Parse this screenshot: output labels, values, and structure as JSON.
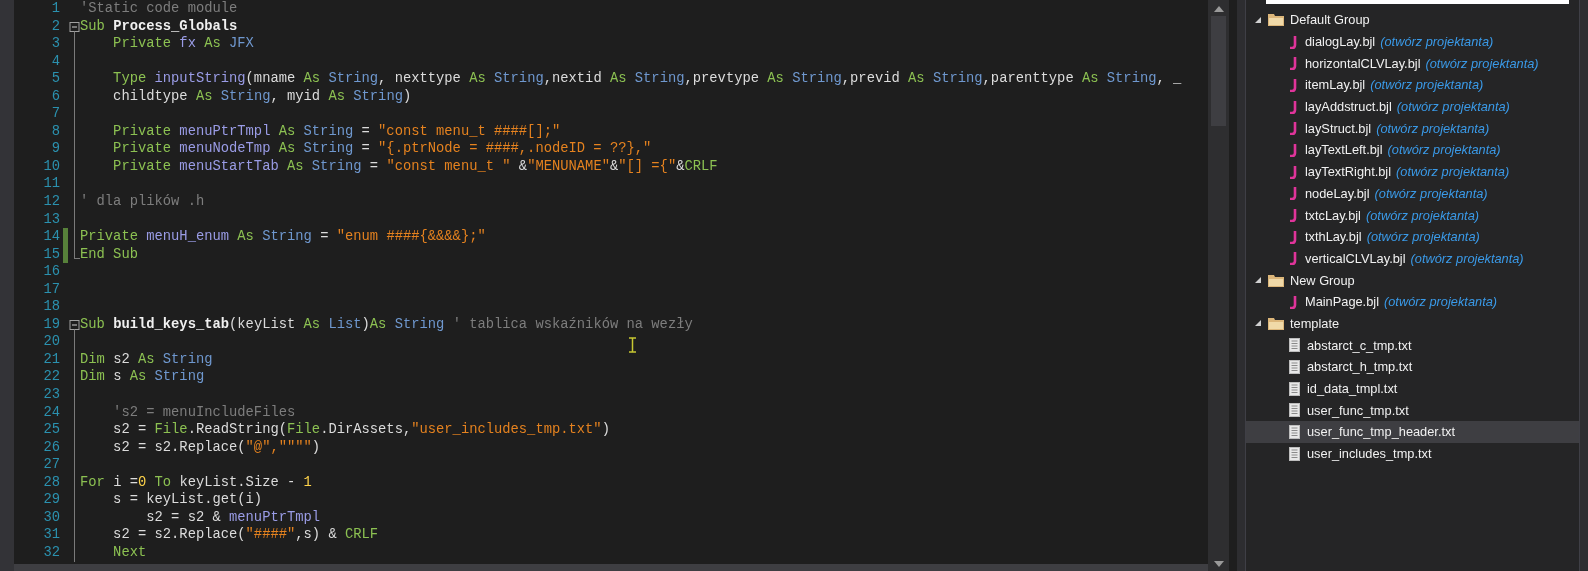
{
  "editor": {
    "lines": [
      {
        "number": "1",
        "kind": "plain",
        "modified": false,
        "tokens": [
          {
            "kind": "comment",
            "text": "'Static code module"
          }
        ]
      },
      {
        "number": "2",
        "kind": "fold_start",
        "modified": false,
        "tokens": [
          {
            "kind": "keyword",
            "text": "Sub "
          },
          {
            "kind": "name",
            "text": "Process_Globals"
          }
        ]
      },
      {
        "number": "3",
        "kind": "in_fold",
        "modified": false,
        "tokens": [
          {
            "kind": "keyword",
            "text": "    Private "
          },
          {
            "kind": "identifier",
            "text": "fx "
          },
          {
            "kind": "keyword",
            "text": "As "
          },
          {
            "kind": "type",
            "text": "JFX"
          }
        ]
      },
      {
        "number": "4",
        "kind": "in_fold",
        "modified": false
      },
      {
        "number": "5",
        "kind": "in_fold",
        "modified": false,
        "tokens": [
          {
            "kind": "keyword",
            "text": "    Type "
          },
          {
            "kind": "identifier",
            "text": "inputString"
          },
          {
            "kind": "plain",
            "text": "(mname "
          },
          {
            "kind": "keyword",
            "text": "As "
          },
          {
            "kind": "type",
            "text": "String"
          },
          {
            "kind": "plain",
            "text": ", nexttype "
          },
          {
            "kind": "keyword",
            "text": "As "
          },
          {
            "kind": "type",
            "text": "String"
          },
          {
            "kind": "plain",
            "text": ",nextid "
          },
          {
            "kind": "keyword",
            "text": "As "
          },
          {
            "kind": "type",
            "text": "String"
          },
          {
            "kind": "plain",
            "text": ",prevtype "
          },
          {
            "kind": "keyword",
            "text": "As "
          },
          {
            "kind": "type",
            "text": "String"
          },
          {
            "kind": "plain",
            "text": ",previd "
          },
          {
            "kind": "keyword",
            "text": "As "
          },
          {
            "kind": "type",
            "text": "String"
          },
          {
            "kind": "plain",
            "text": ",parenttype "
          },
          {
            "kind": "keyword",
            "text": "As "
          },
          {
            "kind": "type",
            "text": "String"
          },
          {
            "kind": "plain",
            "text": ", _"
          }
        ]
      },
      {
        "number": "6",
        "kind": "in_fold",
        "modified": false,
        "tokens": [
          {
            "kind": "plain",
            "text": "    childtype "
          },
          {
            "kind": "keyword",
            "text": "As "
          },
          {
            "kind": "type",
            "text": "String"
          },
          {
            "kind": "plain",
            "text": ", myid "
          },
          {
            "kind": "keyword",
            "text": "As "
          },
          {
            "kind": "type",
            "text": "String"
          },
          {
            "kind": "plain",
            "text": ")"
          }
        ]
      },
      {
        "number": "7",
        "kind": "in_fold",
        "modified": false
      },
      {
        "number": "8",
        "kind": "in_fold",
        "modified": false,
        "tokens": [
          {
            "kind": "keyword",
            "text": "    Private "
          },
          {
            "kind": "identifier",
            "text": "menuPtrTmpl "
          },
          {
            "kind": "keyword",
            "text": "As "
          },
          {
            "kind": "type",
            "text": "String"
          },
          {
            "kind": "plain",
            "text": " = "
          },
          {
            "kind": "string",
            "text": "\"const menu_t ####[];\""
          }
        ]
      },
      {
        "number": "9",
        "kind": "in_fold",
        "modified": false,
        "tokens": [
          {
            "kind": "keyword",
            "text": "    Private "
          },
          {
            "kind": "identifier",
            "text": "menuNodeTmp "
          },
          {
            "kind": "keyword",
            "text": "As "
          },
          {
            "kind": "type",
            "text": "String"
          },
          {
            "kind": "plain",
            "text": " = "
          },
          {
            "kind": "string",
            "text": "\"{.ptrNode = ####,.nodeID = ??},\""
          }
        ]
      },
      {
        "number": "10",
        "kind": "in_fold",
        "modified": false,
        "tokens": [
          {
            "kind": "keyword",
            "text": "    Private "
          },
          {
            "kind": "identifier",
            "text": "menuStartTab "
          },
          {
            "kind": "keyword",
            "text": "As "
          },
          {
            "kind": "type",
            "text": "String"
          },
          {
            "kind": "plain",
            "text": " = "
          },
          {
            "kind": "string",
            "text": "\"const menu_t \""
          },
          {
            "kind": "plain",
            "text": " &"
          },
          {
            "kind": "string",
            "text": "\"MENUNAME\""
          },
          {
            "kind": "plain",
            "text": "&"
          },
          {
            "kind": "string",
            "text": "\"[] ={\""
          },
          {
            "kind": "plain",
            "text": "&"
          },
          {
            "kind": "keyword",
            "text": "CRLF"
          }
        ]
      },
      {
        "number": "11",
        "kind": "in_fold",
        "modified": false
      },
      {
        "number": "12",
        "kind": "in_fold",
        "modified": false,
        "tokens": [
          {
            "kind": "comment",
            "text": "' dla plików .h"
          }
        ]
      },
      {
        "number": "13",
        "kind": "in_fold",
        "modified": false
      },
      {
        "number": "14",
        "kind": "in_fold",
        "modified": true,
        "tokens": [
          {
            "kind": "keyword",
            "text": "Private "
          },
          {
            "kind": "identifier",
            "text": "menuH_enum "
          },
          {
            "kind": "keyword",
            "text": "As "
          },
          {
            "kind": "type",
            "text": "String"
          },
          {
            "kind": "plain",
            "text": " = "
          },
          {
            "kind": "string",
            "text": "\"enum ####{&&&&};\""
          }
        ]
      },
      {
        "number": "15",
        "kind": "fold_end",
        "modified": true,
        "tokens": [
          {
            "kind": "keyword",
            "text": "End Sub"
          }
        ]
      },
      {
        "number": "16",
        "kind": "plain",
        "modified": false
      },
      {
        "number": "17",
        "kind": "plain",
        "modified": false
      },
      {
        "number": "18",
        "kind": "plain",
        "modified": false
      },
      {
        "number": "19",
        "kind": "fold_start",
        "modified": false,
        "tokens": [
          {
            "kind": "keyword",
            "text": "Sub "
          },
          {
            "kind": "name",
            "text": "build_keys_tab"
          },
          {
            "kind": "plain",
            "text": "(keyList "
          },
          {
            "kind": "keyword",
            "text": "As "
          },
          {
            "kind": "type",
            "text": "List"
          },
          {
            "kind": "plain",
            "text": ")"
          },
          {
            "kind": "keyword",
            "text": "As "
          },
          {
            "kind": "type",
            "text": "String "
          },
          {
            "kind": "comment",
            "text": "' tablica wskaźników na wezły"
          }
        ]
      },
      {
        "number": "20",
        "kind": "in_fold",
        "modified": false
      },
      {
        "number": "21",
        "kind": "in_fold",
        "modified": false,
        "tokens": [
          {
            "kind": "keyword",
            "text": "Dim "
          },
          {
            "kind": "plain",
            "text": "s2 "
          },
          {
            "kind": "keyword",
            "text": "As "
          },
          {
            "kind": "type",
            "text": "String"
          }
        ]
      },
      {
        "number": "22",
        "kind": "in_fold",
        "modified": false,
        "tokens": [
          {
            "kind": "keyword",
            "text": "Dim "
          },
          {
            "kind": "plain",
            "text": "s "
          },
          {
            "kind": "keyword",
            "text": "As "
          },
          {
            "kind": "type",
            "text": "String"
          }
        ]
      },
      {
        "number": "23",
        "kind": "in_fold",
        "modified": false
      },
      {
        "number": "24",
        "kind": "in_fold",
        "modified": false,
        "tokens": [
          {
            "kind": "comment",
            "text": "    's2 = menuIncludeFiles"
          }
        ]
      },
      {
        "number": "25",
        "kind": "in_fold",
        "modified": false,
        "tokens": [
          {
            "kind": "plain",
            "text": "    s2 = "
          },
          {
            "kind": "keyword",
            "text": "File"
          },
          {
            "kind": "plain",
            "text": ".ReadString("
          },
          {
            "kind": "keyword",
            "text": "File"
          },
          {
            "kind": "plain",
            "text": ".DirAssets,"
          },
          {
            "kind": "string",
            "text": "\"user_includes_tmp.txt\""
          },
          {
            "kind": "plain",
            "text": ")"
          }
        ]
      },
      {
        "number": "26",
        "kind": "in_fold",
        "modified": false,
        "tokens": [
          {
            "kind": "plain",
            "text": "    s2 = s2.Replace("
          },
          {
            "kind": "string",
            "text": "\"@\",\"\"\"\""
          },
          {
            "kind": "plain",
            "text": ")"
          }
        ]
      },
      {
        "number": "27",
        "kind": "in_fold",
        "modified": false
      },
      {
        "number": "28",
        "kind": "in_fold",
        "modified": false,
        "tokens": [
          {
            "kind": "keyword",
            "text": "For "
          },
          {
            "kind": "plain",
            "text": "i ="
          },
          {
            "kind": "number",
            "text": "0 "
          },
          {
            "kind": "keyword",
            "text": "To "
          },
          {
            "kind": "plain",
            "text": "keyList.Size - "
          },
          {
            "kind": "number",
            "text": "1"
          }
        ]
      },
      {
        "number": "29",
        "kind": "in_fold",
        "modified": false,
        "tokens": [
          {
            "kind": "plain",
            "text": "    s = keyList.get(i)"
          }
        ]
      },
      {
        "number": "30",
        "kind": "in_fold",
        "modified": false,
        "tokens": [
          {
            "kind": "plain",
            "text": "        s2 = s2 & "
          },
          {
            "kind": "identifier",
            "text": "menuPtrTmpl"
          }
        ]
      },
      {
        "number": "31",
        "kind": "in_fold",
        "modified": false,
        "tokens": [
          {
            "kind": "plain",
            "text": "    s2 = s2.Replace("
          },
          {
            "kind": "string",
            "text": "\"####\""
          },
          {
            "kind": "plain",
            "text": ",s) & "
          },
          {
            "kind": "keyword",
            "text": "CRLF"
          }
        ]
      },
      {
        "number": "32",
        "kind": "in_fold",
        "modified": false,
        "tokens": [
          {
            "kind": "keyword",
            "text": "    Next"
          }
        ]
      }
    ]
  },
  "project_tree": {
    "groups": [
      {
        "label": "Default Group",
        "expanded": true,
        "children": [
          {
            "kind": "layout",
            "label": "dialogLay.bjl",
            "action": "(otwórz projektanta)",
            "selected": false
          },
          {
            "kind": "layout",
            "label": "horizontalCLVLay.bjl",
            "action": "(otwórz projektanta)",
            "selected": false
          },
          {
            "kind": "layout",
            "label": "itemLay.bjl",
            "action": "(otwórz projektanta)",
            "selected": false
          },
          {
            "kind": "layout",
            "label": "layAddstruct.bjl",
            "action": "(otwórz projektanta)",
            "selected": false
          },
          {
            "kind": "layout",
            "label": "layStruct.bjl",
            "action": "(otwórz projektanta)",
            "selected": false
          },
          {
            "kind": "layout",
            "label": "layTextLeft.bjl",
            "action": "(otwórz projektanta)",
            "selected": false
          },
          {
            "kind": "layout",
            "label": "layTextRight.bjl",
            "action": "(otwórz projektanta)",
            "selected": false
          },
          {
            "kind": "layout",
            "label": "nodeLay.bjl",
            "action": "(otwórz projektanta)",
            "selected": false
          },
          {
            "kind": "layout",
            "label": "txtcLay.bjl",
            "action": "(otwórz projektanta)",
            "selected": false
          },
          {
            "kind": "layout",
            "label": "txthLay.bjl",
            "action": "(otwórz projektanta)",
            "selected": false
          },
          {
            "kind": "layout",
            "label": "verticalCLVLay.bjl",
            "action": "(otwórz projektanta)",
            "selected": false
          }
        ]
      },
      {
        "label": "New Group",
        "expanded": true,
        "children": [
          {
            "kind": "layout",
            "label": "MainPage.bjl",
            "action": "(otwórz projektanta)",
            "selected": false
          }
        ]
      },
      {
        "label": "template",
        "expanded": true,
        "children": [
          {
            "kind": "file",
            "label": "abstarct_c_tmp.txt",
            "selected": false
          },
          {
            "kind": "file",
            "label": "abstarct_h_tmp.txt",
            "selected": false
          },
          {
            "kind": "file",
            "label": "id_data_tmpl.txt",
            "selected": false
          },
          {
            "kind": "file",
            "label": "user_func_tmp.txt",
            "selected": false
          },
          {
            "kind": "file",
            "label": "user_func_tmp_header.txt",
            "selected": true
          },
          {
            "kind": "file",
            "label": "user_includes_tmp.txt",
            "selected": false
          }
        ]
      }
    ]
  }
}
